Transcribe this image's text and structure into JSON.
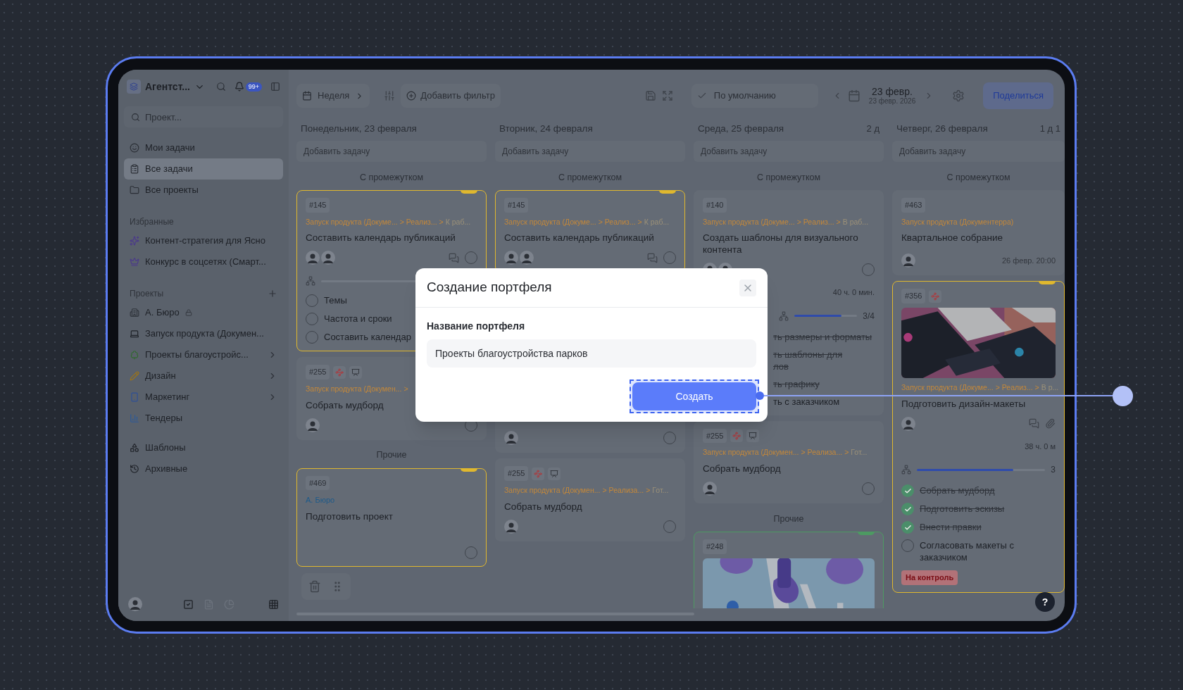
{
  "sidebar": {
    "workspace": "Агентст...",
    "notifications": "99+",
    "search": {
      "placeholder": "Проект..."
    },
    "nav": [
      {
        "label": "Мои задачи",
        "selected": false
      },
      {
        "label": "Все задачи",
        "selected": true
      },
      {
        "label": "Все проекты",
        "selected": false
      }
    ],
    "favorites_title": "Избранные",
    "favorites": [
      {
        "label": "Контент-стратегия для Ясно"
      },
      {
        "label": "Конкурс в соцсетях (Смарт..."
      }
    ],
    "projects_title": "Проекты",
    "projects": [
      {
        "label": "А. Бюро",
        "locked": true,
        "has_children": false
      },
      {
        "label": "Запуск продукта (Докумен...",
        "locked": false,
        "has_children": false
      },
      {
        "label": "Проекты благоустройс...",
        "locked": false,
        "has_children": true
      },
      {
        "label": "Дизайн",
        "locked": false,
        "has_children": true
      },
      {
        "label": "Маркетинг",
        "locked": false,
        "has_children": true
      },
      {
        "label": "Тендеры",
        "locked": false,
        "has_children": false
      }
    ],
    "extra": [
      {
        "label": "Шаблоны"
      },
      {
        "label": "Архивные"
      }
    ]
  },
  "toolbar": {
    "view": "Неделя",
    "filter": "Добавить фильтр",
    "sort": "По умолчанию",
    "date": "23 февр.",
    "date_sub": "23 февр. 2026",
    "share": "Поделиться"
  },
  "columns": [
    {
      "title": "Понедельник, 23 февраля",
      "add_placeholder": "Добавить задачу",
      "groups": [
        {
          "title": "С промежутком",
          "cards": [
            {
              "id": "#145",
              "color": "#e0b82e",
              "path": [
                {
                  "text": "Запуск продукта (Докуме...",
                  "faded": false
                },
                {
                  "text": ">",
                  "faded": false
                },
                {
                  "text": "Реализ...",
                  "faded": false
                },
                {
                  "text": ">",
                  "faded": false
                },
                {
                  "text": "К раб...",
                  "faded": true
                }
              ],
              "title": "Составить календарь публикаций",
              "assignees": [
                {
                  "kind": "avatar"
                },
                {
                  "kind": "avatar"
                }
              ],
              "actions": [
                {
                  "kind": "comment"
                }
              ],
              "done": false,
              "subtasks": [
                {
                  "text": "Темы",
                  "done": false
                },
                {
                  "text": "Частота и сроки",
                  "done": false
                },
                {
                  "text": "Составить календар",
                  "done": false
                }
              ]
            },
            {
              "id": "#255",
              "markers": [
                {
                  "kind": "dependency"
                },
                {
                  "kind": "note"
                }
              ],
              "path": [
                {
                  "text": "Запуск продукта (Докумен...",
                  "faded": false
                },
                {
                  "text": ">",
                  "faded": false
                }
              ],
              "title": "Собрать мудборд",
              "assignees": [
                {
                  "kind": "avatar"
                }
              ],
              "done": false
            }
          ]
        },
        {
          "title": "Прочие",
          "cards": [
            {
              "id": "#469",
              "color": "#e0b82e",
              "project": "А. Бюро",
              "title": "Подготовить проект",
              "done": false
            }
          ]
        }
      ]
    },
    {
      "title": "Вторник, 24 февраля",
      "add_placeholder": "Добавить задачу",
      "groups": [
        {
          "title": "С промежутком",
          "cards": [
            {
              "id": "#145",
              "color": "#e0b82e",
              "path": [
                {
                  "text": "Запуск продукта (Докуме...",
                  "faded": false
                },
                {
                  "text": ">",
                  "faded": false
                },
                {
                  "text": "Реализ...",
                  "faded": false
                },
                {
                  "text": ">",
                  "faded": false
                },
                {
                  "text": "К раб...",
                  "faded": true
                }
              ],
              "title": "Составить календарь публикаций",
              "assignees": [
                {
                  "kind": "avatar"
                },
                {
                  "kind": "avatar"
                }
              ],
              "actions": [
                {
                  "kind": "comment"
                }
              ],
              "done": false
            },
            {
              "assignees": [
                {
                  "kind": "avatar"
                }
              ],
              "done": false
            },
            {
              "id": "#255",
              "markers": [
                {
                  "kind": "dependency"
                },
                {
                  "kind": "note"
                }
              ],
              "path": [
                {
                  "text": "Запуск продукта (Докумен...",
                  "faded": false
                },
                {
                  "text": ">",
                  "faded": false
                },
                {
                  "text": "Реализа...",
                  "faded": false
                },
                {
                  "text": ">",
                  "faded": false
                },
                {
                  "text": "Гот...",
                  "faded": true
                }
              ],
              "title": "Собрать мудборд",
              "assignees": [
                {
                  "kind": "avatar"
                }
              ],
              "done": false
            }
          ]
        }
      ]
    },
    {
      "title": "Среда, 25 февраля",
      "duration": "2 д",
      "add_placeholder": "Добавить задачу",
      "groups": [
        {
          "title": "С промежутком",
          "cards": [
            {
              "id": "#140",
              "path": [
                {
                  "text": "Запуск продукта (Докуме...",
                  "faded": false
                },
                {
                  "text": ">",
                  "faded": false
                },
                {
                  "text": "Реализ...",
                  "faded": false
                },
                {
                  "text": ">",
                  "faded": false
                },
                {
                  "text": "В раб...",
                  "faded": true
                }
              ],
              "title": "Создать шаблоны для визуального контента",
              "assignees": [
                {
                  "kind": "avatar"
                },
                {
                  "kind": "avatar"
                }
              ],
              "done": false,
              "time": "40 ч. 0 мин.",
              "covered": true,
              "progress": {
                "level": 0.75,
                "reading": "3/4"
              },
              "subtasks": [
                {
                  "text": "ть размеры и форматы",
                  "done": true
                },
                {
                  "text": "ть шаблоны для\nлов",
                  "done": true
                },
                {
                  "text": "ть графику",
                  "done": true
                },
                {
                  "text": "ть с заказчиком",
                  "done": false
                }
              ]
            },
            {
              "id": "#255",
              "markers": [
                {
                  "kind": "dependency"
                },
                {
                  "kind": "note"
                }
              ],
              "path": [
                {
                  "text": "Запуск продукта (Докумен...",
                  "faded": false
                },
                {
                  "text": ">",
                  "faded": false
                },
                {
                  "text": "Реализа...",
                  "faded": false
                },
                {
                  "text": ">",
                  "faded": false
                },
                {
                  "text": "Гот...",
                  "faded": true
                }
              ],
              "title": "Собрать мудборд",
              "assignees": [
                {
                  "kind": "avatar"
                }
              ],
              "done": false
            }
          ]
        },
        {
          "title": "Прочие",
          "cards": [
            {
              "id": "#248",
              "color": "#4d9a62",
              "cover": {
                "kind": "picture"
              }
            }
          ]
        }
      ]
    },
    {
      "title": "Четверг, 26 февраля",
      "duration": "1 д 1",
      "add_placeholder": "Добавить задачу",
      "groups": [
        {
          "title": "С промежутком",
          "cards": [
            {
              "id": "#463",
              "path": [
                {
                  "text": "Запуск продукта (Документерра)",
                  "faded": false
                }
              ],
              "title": "Квартальное собрание",
              "assignees": [
                {
                  "kind": "avatar"
                }
              ],
              "due": "26 февр. 20:00"
            },
            {
              "id": "#356",
              "color": "#e0b82e",
              "markers": [
                {
                  "kind": "dependency"
                }
              ],
              "cover": {
                "kind": "picture"
              },
              "path": [
                {
                  "text": "Запуск продукта (Докуме...",
                  "faded": false
                },
                {
                  "text": ">",
                  "faded": false
                },
                {
                  "text": "Реализ...",
                  "faded": false
                },
                {
                  "text": ">",
                  "faded": false
                },
                {
                  "text": "В р...",
                  "faded": true
                }
              ],
              "title": "Подготовить дизайн-макеты",
              "assignees": [
                {
                  "kind": "avatar"
                }
              ],
              "actions": [
                {
                  "kind": "comment"
                },
                {
                  "kind": "attachment"
                }
              ],
              "time": "38 ч. 0 м",
              "progress": {
                "level": 0.75,
                "reading": "3"
              },
              "subtasks": [
                {
                  "text": "Собрать мудборд",
                  "done": true
                },
                {
                  "text": "Подготовить эскизы",
                  "done": true
                },
                {
                  "text": "Внести правки",
                  "done": true
                },
                {
                  "text": "Согласовать макеты с заказчиком",
                  "done": false
                }
              ],
              "status": "На контроль"
            }
          ]
        }
      ]
    }
  ],
  "help": "?",
  "modal": {
    "title": "Создание портфеля",
    "field_label": "Название портфеля",
    "field_value": "Проекты благоустройства парков",
    "submit": "Создать"
  }
}
